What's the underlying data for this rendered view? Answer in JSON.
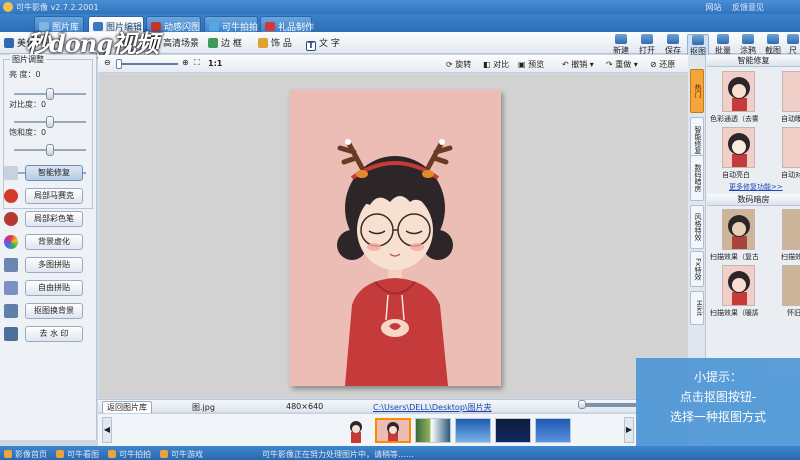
{
  "title_bar": {
    "app_name": "可牛影像  v2.7.2.2001",
    "links": [
      "网站",
      "反馈意见"
    ]
  },
  "tabs": [
    {
      "label": "图片库",
      "active": false
    },
    {
      "label": "图片编辑",
      "active": true
    },
    {
      "label": "动感闪图",
      "active": false
    },
    {
      "label": "可牛拍拍",
      "active": false
    },
    {
      "label": "礼品制作",
      "active": false
    }
  ],
  "toolbar": {
    "left_items": [
      "美化",
      "高清场景",
      "边 框",
      "饰 品",
      "文 字"
    ],
    "right_tools": [
      {
        "label": "新建",
        "active": false
      },
      {
        "label": "打开",
        "active": false
      },
      {
        "label": "保存",
        "active": false
      },
      {
        "label": "抠图",
        "active": true
      },
      {
        "label": "批量",
        "active": false
      },
      {
        "label": "涂鸦",
        "active": false
      },
      {
        "label": "截图",
        "active": false
      },
      {
        "label": "尺寸",
        "active": false
      }
    ]
  },
  "watermark": "秒dong视频",
  "adjust_panel": {
    "title": "图片调整",
    "sliders": [
      {
        "label": "亮  度：0",
        "value": 0
      },
      {
        "label": "对比度：0",
        "value": 0
      },
      {
        "label": "饱和度：0",
        "value": 0
      }
    ],
    "extra_slider_value": 0
  },
  "left_buttons": [
    {
      "label": "智能修复",
      "icon": "wand-icon",
      "color": "#c7d2df",
      "active": true
    },
    {
      "label": "局部马赛克",
      "icon": "heart-mosaic-icon",
      "color": "#d23a2a",
      "active": false
    },
    {
      "label": "局部彩色笔",
      "icon": "apple-icon",
      "color": "#b33a30",
      "active": false
    },
    {
      "label": "背景虚化",
      "icon": "color-wheel-icon",
      "color": "#6a5bd0",
      "active": false
    },
    {
      "label": "多图拼贴",
      "icon": "collage-icon",
      "color": "#6b86b0",
      "active": false
    },
    {
      "label": "自由拼贴",
      "icon": "free-collage-icon",
      "color": "#7a93c2",
      "active": false
    },
    {
      "label": "抠图换背景",
      "icon": "cutout-icon",
      "color": "#5f80a8",
      "active": false
    },
    {
      "label": "去 水 印",
      "icon": "watermark-remove-icon",
      "color": "#4d6f99",
      "active": false
    }
  ],
  "canvas_controls": {
    "zoom_label": "1:1",
    "actions": [
      "旋转",
      "对比",
      "预览",
      "撤销",
      "重做",
      "还原"
    ]
  },
  "status": {
    "back_button": "返回图片库",
    "file_name": "图.jpg",
    "dimensions": "480×640",
    "path": "C:\\Users\\DELL\\Desktop\\图片夹"
  },
  "filmstrip": {
    "prev": "◀",
    "next": "▶",
    "thumbs": 5
  },
  "right_panel": {
    "vertical_tabs": [
      "热门",
      "智能修复",
      "数码暗房",
      "风格特效",
      "Fx特效",
      "Hikit"
    ],
    "active_tab": 0,
    "section1_title": "智能修复",
    "section1_items": [
      "色彩通透（去雾）",
      "自动曝光",
      "自动亮白",
      "自动对比"
    ],
    "more_link": "更多修复功能>>",
    "section2_title": "数码暗房",
    "section2_items": [
      "扫描效果（复古）",
      "扫描效果（彩色）",
      "扫描效果（暖調）",
      "怀旧"
    ]
  },
  "tip": {
    "title": "小提示：",
    "line1": "点击抠图按钮-",
    "line2": "选择一种抠图方式"
  },
  "bottom_bar": {
    "items": [
      "影像首页",
      "可牛看图",
      "可牛拍拍",
      "可牛游戏"
    ],
    "message": "可牛影像正在努力处理图片中，请稍等……"
  },
  "colors": {
    "title_blue": "#2f73bd",
    "accent_orange": "#ff8a00",
    "tip_blue": "#4f97d6",
    "photo_bg": "#ebbdb5",
    "hoodie_red": "#c53a3a"
  }
}
